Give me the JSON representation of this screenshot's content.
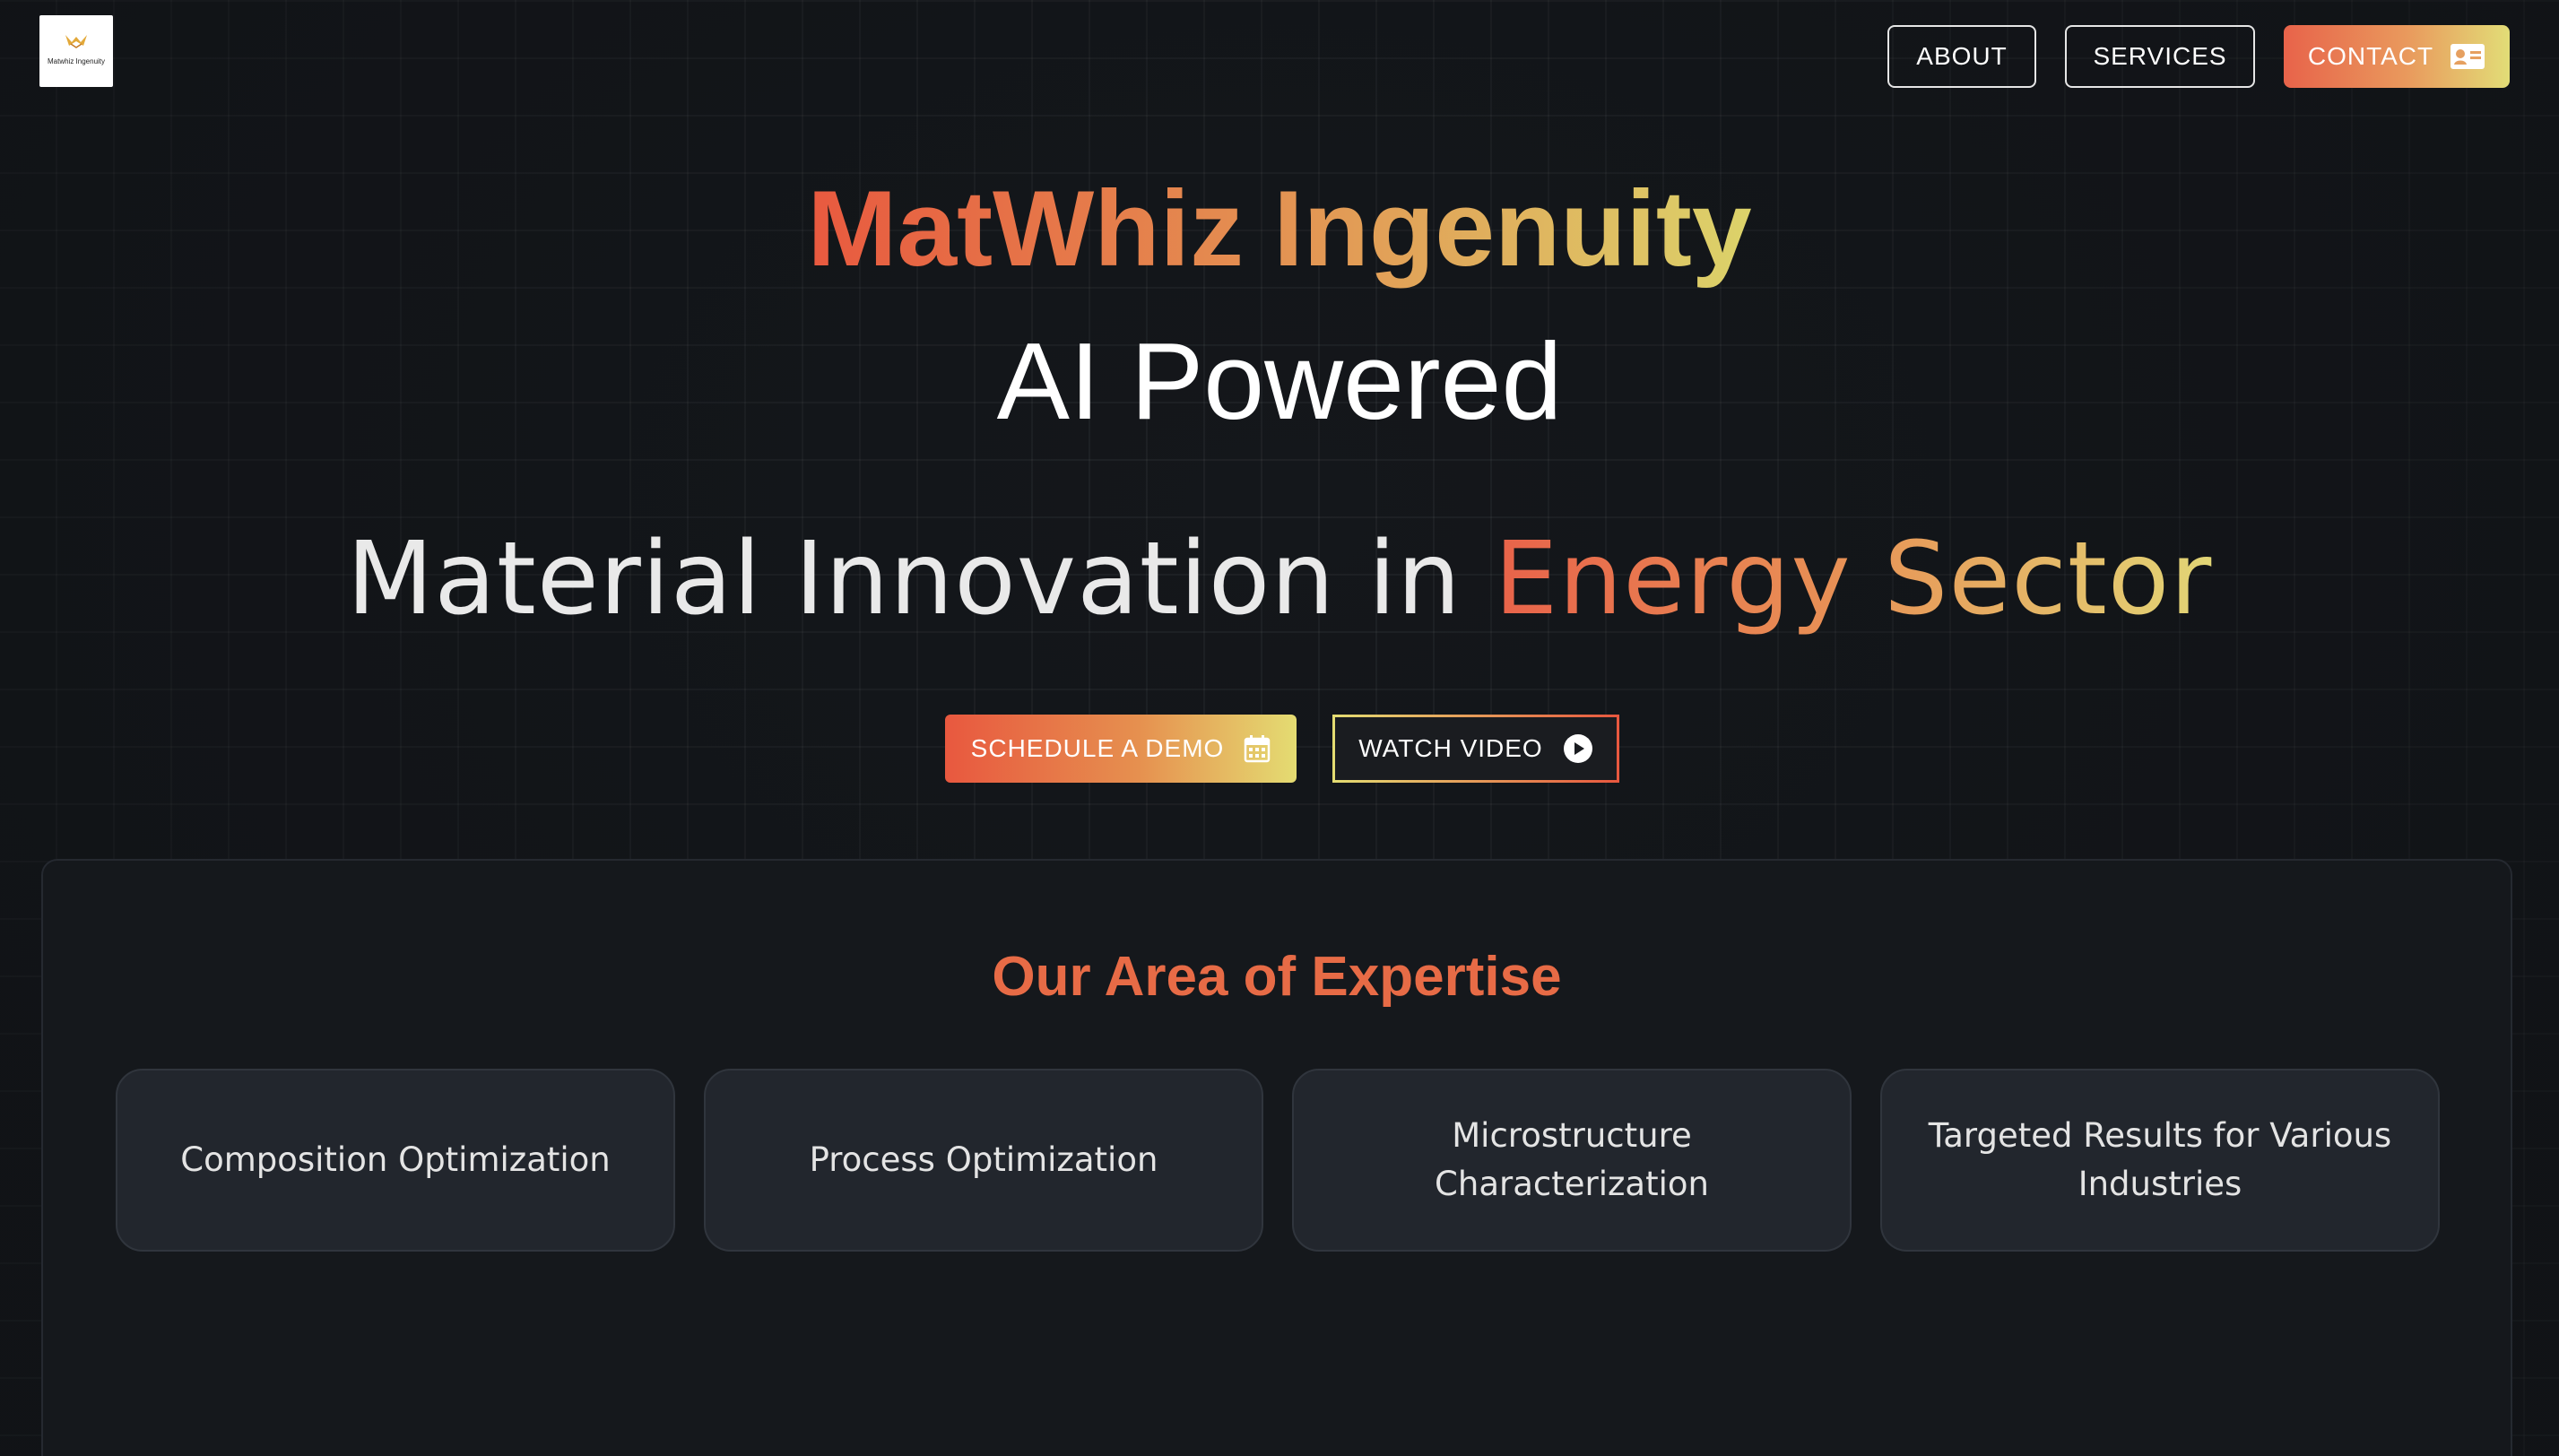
{
  "header": {
    "logo_text": "Matwhiz Ingenuity",
    "nav": {
      "about": "ABOUT",
      "services": "SERVICES",
      "contact": "CONTACT"
    }
  },
  "hero": {
    "title": "MatWhiz Ingenuity",
    "subtitle": "AI Powered",
    "line_prefix": "Material Innovation in ",
    "line_highlight": "Energy Sector",
    "cta_demo": "SCHEDULE A DEMO",
    "cta_video": "WATCH VIDEO"
  },
  "expertise": {
    "title": "Our Area of Expertise",
    "cards": [
      "Composition Optimization",
      "Process Optimization",
      "Microstructure Characterization",
      "Targeted Results for Various Industries"
    ]
  },
  "colors": {
    "background": "#14171b",
    "accent_start": "#e8593f",
    "accent_end": "#dcd36a",
    "card": "#22262d"
  },
  "icons": {
    "contact": "contact-card-icon",
    "demo": "calendar-icon",
    "video": "play-circle-icon"
  }
}
